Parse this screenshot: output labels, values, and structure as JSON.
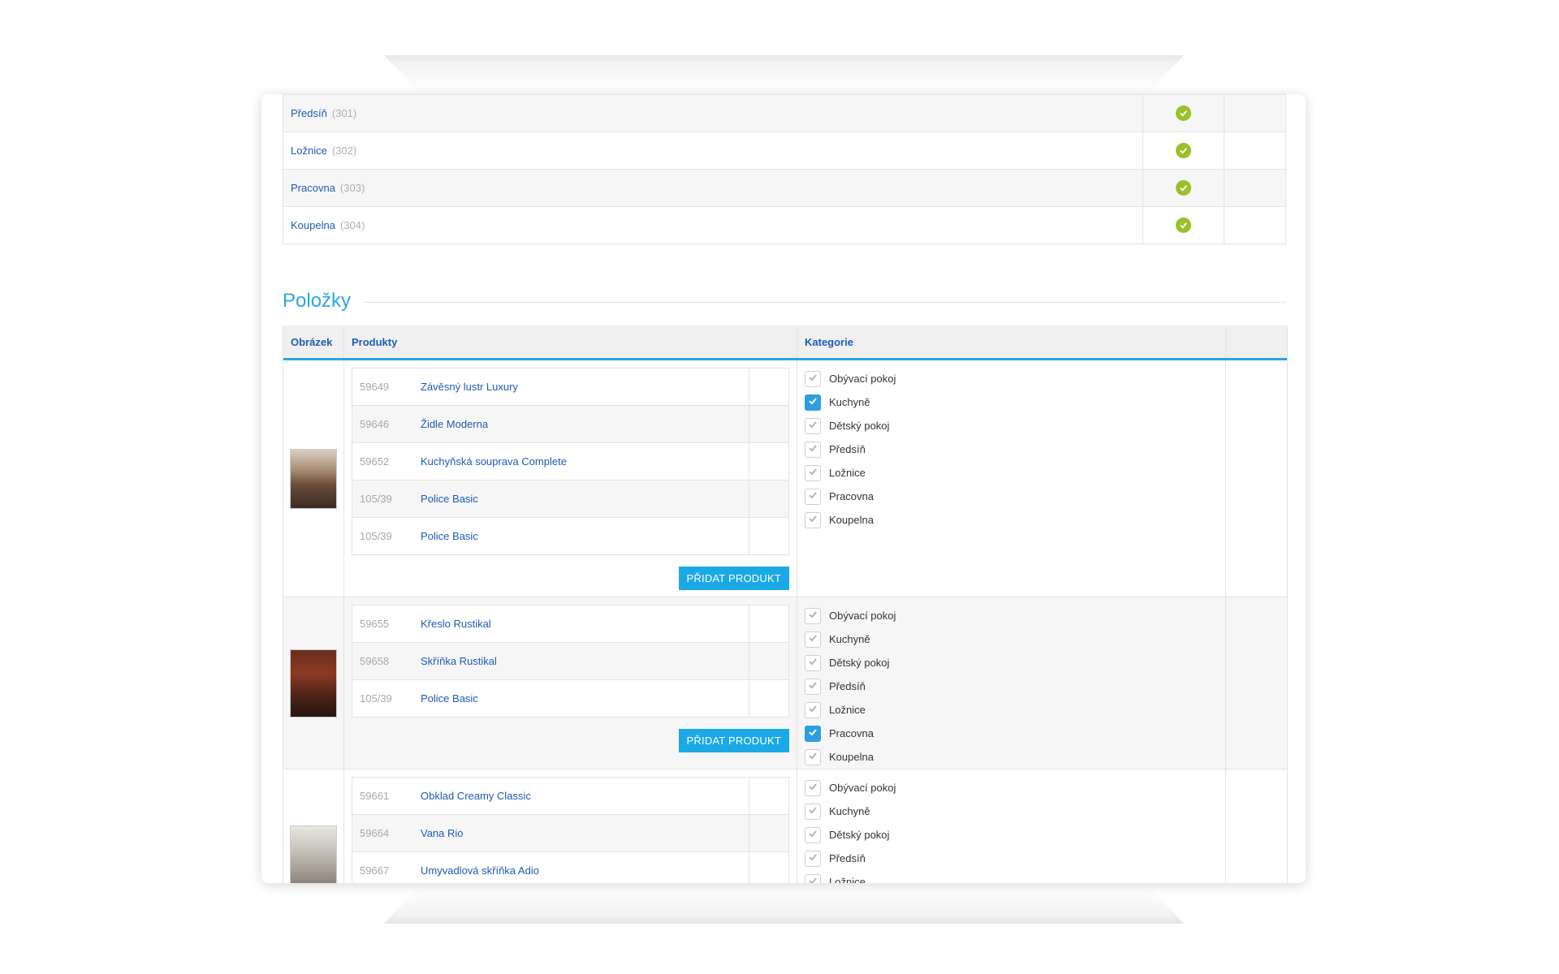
{
  "categories": [
    {
      "name": "Předsíň",
      "id": "(301)",
      "status": "ok"
    },
    {
      "name": "Ložnice",
      "id": "(302)",
      "status": "ok"
    },
    {
      "name": "Pracovna",
      "id": "(303)",
      "status": "ok"
    },
    {
      "name": "Koupelna",
      "id": "(304)",
      "status": "ok"
    }
  ],
  "section": {
    "title": "Položky"
  },
  "table": {
    "headers": {
      "image": "Obrázek",
      "products": "Produkty",
      "categories": "Kategorie"
    }
  },
  "add_button_label": "PŘIDAT PRODUKT",
  "category_options": [
    "Obývací pokoj",
    "Kuchyně",
    "Dětský pokoj",
    "Předsíň",
    "Ložnice",
    "Pracovna",
    "Koupelna"
  ],
  "items": [
    {
      "products": [
        {
          "code": "59649",
          "name": "Závěsný lustr Luxury"
        },
        {
          "code": "59646",
          "name": "Židle Moderna"
        },
        {
          "code": "59652",
          "name": "Kuchyňská souprava Complete"
        },
        {
          "code": "105/39",
          "name": "Police Basic"
        },
        {
          "code": "105/39",
          "name": "Police Basic"
        }
      ],
      "checked": [
        "Kuchyně"
      ]
    },
    {
      "products": [
        {
          "code": "59655",
          "name": "Křeslo Rustikal"
        },
        {
          "code": "59658",
          "name": "Skříňka Rustikal"
        },
        {
          "code": "105/39",
          "name": "Police Basic"
        }
      ],
      "checked": [
        "Pracovna"
      ]
    },
    {
      "products": [
        {
          "code": "59661",
          "name": "Obklad Creamy Classic"
        },
        {
          "code": "59664",
          "name": "Vana Rio"
        },
        {
          "code": "59667",
          "name": "Umyvadlová skříňka Adio"
        }
      ],
      "checked": []
    }
  ],
  "colors": {
    "accent": "#29a8e0",
    "link": "#1d5bb5",
    "ok": "#9bc02b",
    "checkbox_on": "#2d9ee0"
  }
}
